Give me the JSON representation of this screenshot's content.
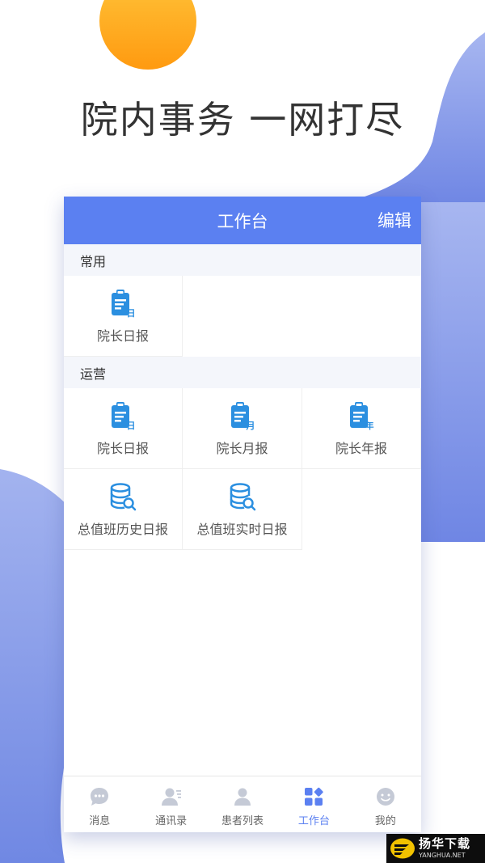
{
  "headline": "院内事务 一网打尽",
  "colors": {
    "accent": "#5b80f1",
    "icon": "#2b8fe0",
    "decor_orange": "#ffa212",
    "decor_blue": "#7e93e6"
  },
  "header": {
    "title": "工作台",
    "edit_label": "编辑"
  },
  "sections": [
    {
      "title": "常用",
      "items": [
        {
          "label": "院长日报",
          "icon": "clipboard-day-icon",
          "badge": "日"
        }
      ]
    },
    {
      "title": "运营",
      "items": [
        {
          "label": "院长日报",
          "icon": "clipboard-day-icon",
          "badge": "日"
        },
        {
          "label": "院长月报",
          "icon": "clipboard-month-icon",
          "badge": "月"
        },
        {
          "label": "院长年报",
          "icon": "clipboard-year-icon",
          "badge": "年"
        },
        {
          "label": "总值班历史日报",
          "icon": "database-search-icon"
        },
        {
          "label": "总值班实时日报",
          "icon": "database-search-icon"
        }
      ]
    }
  ],
  "tabbar": [
    {
      "label": "消息",
      "icon": "chat-icon",
      "active": false
    },
    {
      "label": "通讯录",
      "icon": "contacts-icon",
      "active": false
    },
    {
      "label": "患者列表",
      "icon": "person-icon",
      "active": false
    },
    {
      "label": "工作台",
      "icon": "grid-icon",
      "active": true
    },
    {
      "label": "我的",
      "icon": "smile-icon",
      "active": false
    }
  ],
  "watermark": {
    "cn": "扬华下载",
    "en": "YANGHUA.NET"
  }
}
